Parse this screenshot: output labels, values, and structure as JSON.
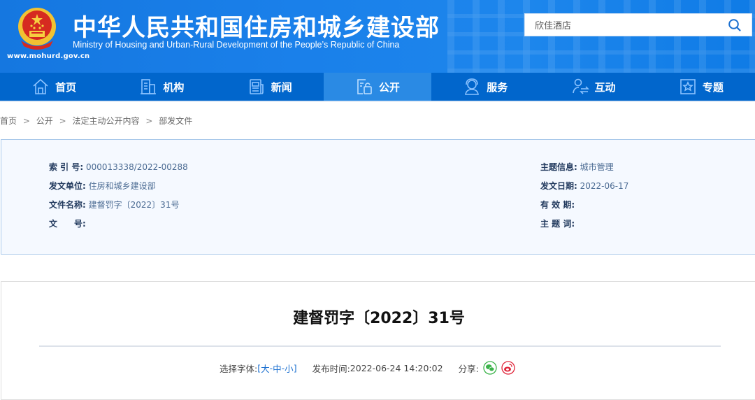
{
  "header": {
    "site_title": "中华人民共和国住房和城乡建设部",
    "site_subtitle": "Ministry of Housing and Urban-Rural Development of the People’s Republic of China",
    "site_url": "www.mohurd.gov.cn",
    "search": {
      "value": "欣佳酒店",
      "placeholder": ""
    }
  },
  "nav": {
    "items": [
      {
        "label": "首页",
        "icon": "home-icon"
      },
      {
        "label": "机构",
        "icon": "building-icon"
      },
      {
        "label": "新闻",
        "icon": "news-icon"
      },
      {
        "label": "公开",
        "icon": "disclosure-icon",
        "active": true
      },
      {
        "label": "服务",
        "icon": "service-icon"
      },
      {
        "label": "互动",
        "icon": "interaction-icon"
      },
      {
        "label": "专题",
        "icon": "topic-icon"
      }
    ]
  },
  "breadcrumb": {
    "items": [
      "首页",
      "公开",
      "法定主动公开内容",
      "部发文件"
    ],
    "separator": ">"
  },
  "info": {
    "left": [
      {
        "label": "索 引 号:",
        "value": "000013338/2022-00288"
      },
      {
        "label": "发文单位:",
        "value": "住房和城乡建设部"
      },
      {
        "label": "文件名称:",
        "value": "建督罚字〔2022〕31号"
      },
      {
        "label": "文　　号:",
        "value": ""
      }
    ],
    "right": [
      {
        "label": "主题信息:",
        "value": "城市管理"
      },
      {
        "label": "发文日期:",
        "value": "2022-06-17"
      },
      {
        "label": "有 效 期:",
        "value": ""
      },
      {
        "label": "主 题 词:",
        "value": ""
      }
    ]
  },
  "article": {
    "title": "建督罚字〔2022〕31号",
    "font_select_label": "选择字体:",
    "font_bracket_open": "[",
    "font_bracket_close": "]",
    "font_options": [
      "大",
      "中",
      "小"
    ],
    "font_sep": "-",
    "publish_label": "发布时间:",
    "publish_time": "2022-06-24 14:20:02",
    "share_label": "分享:"
  },
  "colors": {
    "header_blue": "#1a80ea",
    "nav_blue": "#0166cc",
    "nav_active": "#2a8ae4",
    "link_blue": "#1a6fd0",
    "wechat_green": "#3bb34a",
    "weibo_red": "#e0263b"
  }
}
